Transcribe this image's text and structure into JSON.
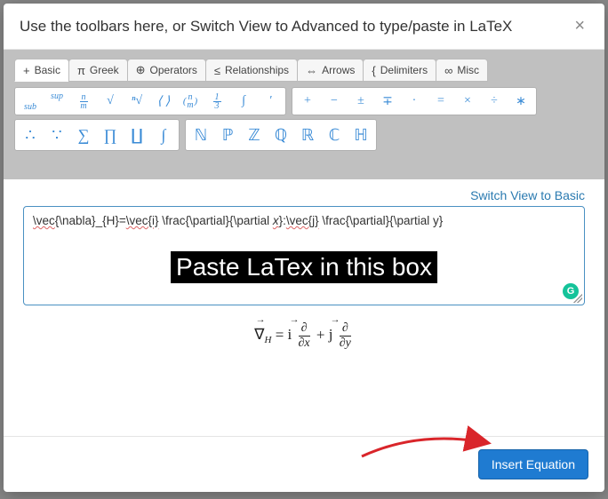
{
  "header": {
    "title": "Use the toolbars here, or Switch View to Advanced to type/paste in LaTeX",
    "close": "×"
  },
  "tabs": [
    {
      "sym": "+",
      "label": "Basic"
    },
    {
      "sym": "π",
      "label": "Greek"
    },
    {
      "sym": "⊕",
      "label": "Operators"
    },
    {
      "sym": "≤",
      "label": "Relationships"
    },
    {
      "sym": "⇔",
      "label": "Arrows"
    },
    {
      "sym": "{",
      "label": "Delimiters"
    },
    {
      "sym": "∞",
      "label": "Misc"
    }
  ],
  "rowA_group1": [
    "sub",
    "sup",
    "n/m",
    "√",
    "ⁿ√",
    "⟨ ⟩",
    "(n m)",
    "⅓",
    "∫",
    "′"
  ],
  "rowA_group2": [
    "+",
    "−",
    "±",
    "∓",
    "·",
    "=",
    "×",
    "÷",
    "∗"
  ],
  "rowB_group1": [
    "∴",
    "∵",
    "∑",
    "∏",
    "∐",
    "∫"
  ],
  "rowB_group2": [
    "ℕ",
    "ℙ",
    "ℤ",
    "ℚ",
    "ℝ",
    "ℂ",
    "ℍ"
  ],
  "switch_link": "Switch View to Basic",
  "editor": {
    "text_parts": [
      "\\vec",
      "{\\nabla}_{H}=",
      "\\vec{i}",
      " \\frac{\\partial}{\\partial ",
      "x",
      "}:",
      "\\vec{j}",
      " \\frac{\\partial}{\\partial y}"
    ],
    "overlay": "Paste LaTex in this box",
    "grammarly": "G"
  },
  "preview": {
    "nabla": "∇",
    "H": "H",
    "eq": " = ",
    "i": "i",
    "j": "j",
    "plus": " + ",
    "partial": "∂",
    "dx": "∂x",
    "dy": "∂y"
  },
  "footer": {
    "insert": "Insert Equation"
  }
}
